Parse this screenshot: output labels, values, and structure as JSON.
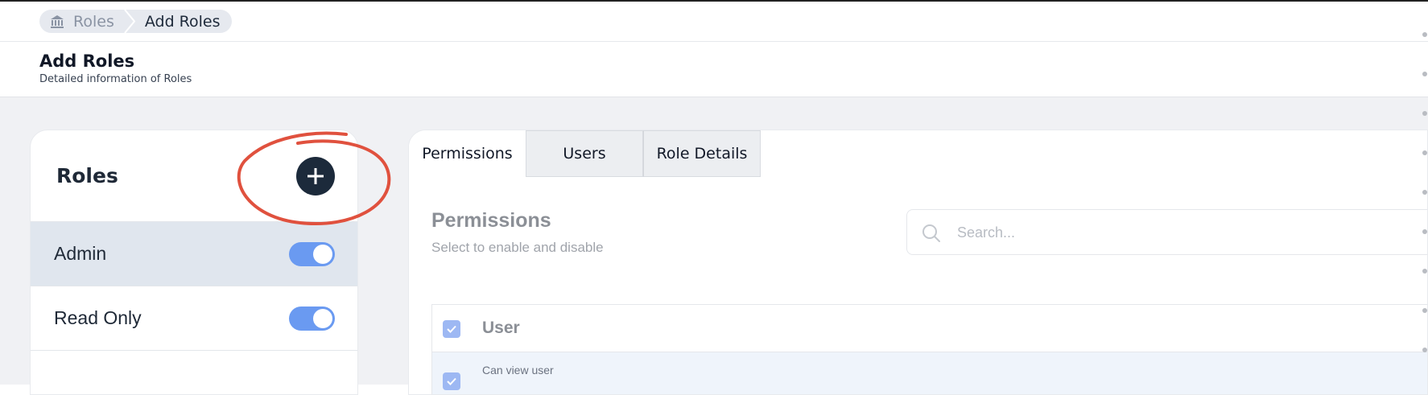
{
  "breadcrumb": {
    "root": "Roles",
    "current": "Add Roles"
  },
  "header": {
    "title": "Add Roles",
    "subtitle": "Detailed information of Roles"
  },
  "roles_panel": {
    "title": "Roles",
    "add_button_icon": "plus-icon",
    "items": [
      {
        "label": "Admin",
        "enabled": true,
        "selected": true
      },
      {
        "label": "Read Only",
        "enabled": true,
        "selected": false
      }
    ]
  },
  "tabs": [
    {
      "label": "Permissions",
      "active": true
    },
    {
      "label": "Users",
      "active": false
    },
    {
      "label": "Role Details",
      "active": false
    }
  ],
  "permissions": {
    "title": "Permissions",
    "subtitle": "Select to enable and disable",
    "search_placeholder": "Search...",
    "groups": [
      {
        "label": "User",
        "checked": true,
        "items": [
          {
            "label": "Can view user",
            "checked": true
          }
        ]
      }
    ]
  },
  "colors": {
    "accent": "#6a9af1",
    "dark": "#1c2a3b",
    "annotation": "#e0513e"
  }
}
